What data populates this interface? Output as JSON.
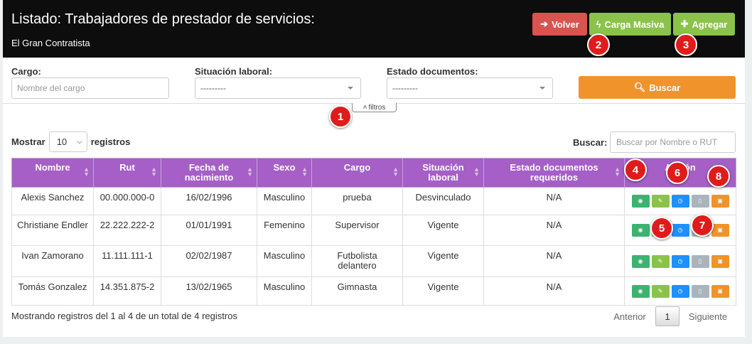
{
  "header": {
    "title": "Listado: Trabajadores de prestador de servicios:",
    "subtitle": "El Gran Contratista",
    "buttons": {
      "volver": "Volver",
      "carga_masiva": "Carga Masiva",
      "agregar": "Agregar"
    }
  },
  "filters": {
    "cargo_label": "Cargo:",
    "cargo_placeholder": "Nombre del cargo",
    "situacion_label": "Situación laboral:",
    "situacion_value": "---------",
    "estado_label": "Estado documentos:",
    "estado_value": "---------",
    "buscar_button": "Buscar",
    "toggle_label": "filtros"
  },
  "table_controls": {
    "mostrar_label": "Mostrar",
    "length_value": "10",
    "registros_label": "registros",
    "search_label": "Buscar:",
    "search_placeholder": "Buscar por Nombre o RUT"
  },
  "table": {
    "headers": [
      "Nombre",
      "Rut",
      "Fecha de nacimiento",
      "Sexo",
      "Cargo",
      "Situación laboral",
      "Estado documentos requeridos",
      "Acción"
    ],
    "rows": [
      [
        "Alexis Sanchez",
        "00.000.000-0",
        "16/02/1996",
        "Masculino",
        "prueba",
        "Desvinculado",
        "N/A"
      ],
      [
        "Christiane Endler",
        "22.222.222-2",
        "01/01/1991",
        "Femenino",
        "Supervisor",
        "Vigente",
        "N/A"
      ],
      [
        "Ivan Zamorano",
        "11.111.111-1",
        "02/02/1987",
        "Masculino",
        "Futbolista delantero",
        "Vigente",
        "N/A"
      ],
      [
        "Tomás Gonzalez",
        "14.351.875-2",
        "13/02/1965",
        "Masculino",
        "Gimnasta",
        "Vigente",
        "N/A"
      ]
    ]
  },
  "footer": {
    "info": "Mostrando registros del 1 al 4 de un total de 4 registros",
    "prev": "Anterior",
    "page": "1",
    "next": "Siguiente"
  },
  "badges": [
    "1",
    "2",
    "3",
    "4",
    "5",
    "6",
    "7",
    "8"
  ],
  "colors": {
    "header_bg": "#0d0d0d",
    "table_header": "#a55fc6",
    "danger": "#d9534f",
    "success": "#8bc34a",
    "warning": "#f0932b",
    "info": "#1e90ff",
    "teal": "#3cb371",
    "badge": "#e01b1b"
  },
  "icons": [
    "arrow-left-icon",
    "bolt-icon",
    "plus-icon",
    "search-icon",
    "chevron-up-icon",
    "eye-icon",
    "pencil-icon",
    "clock-icon",
    "document-icon",
    "id-card-icon",
    "sort-icon",
    "caret-down-icon"
  ]
}
